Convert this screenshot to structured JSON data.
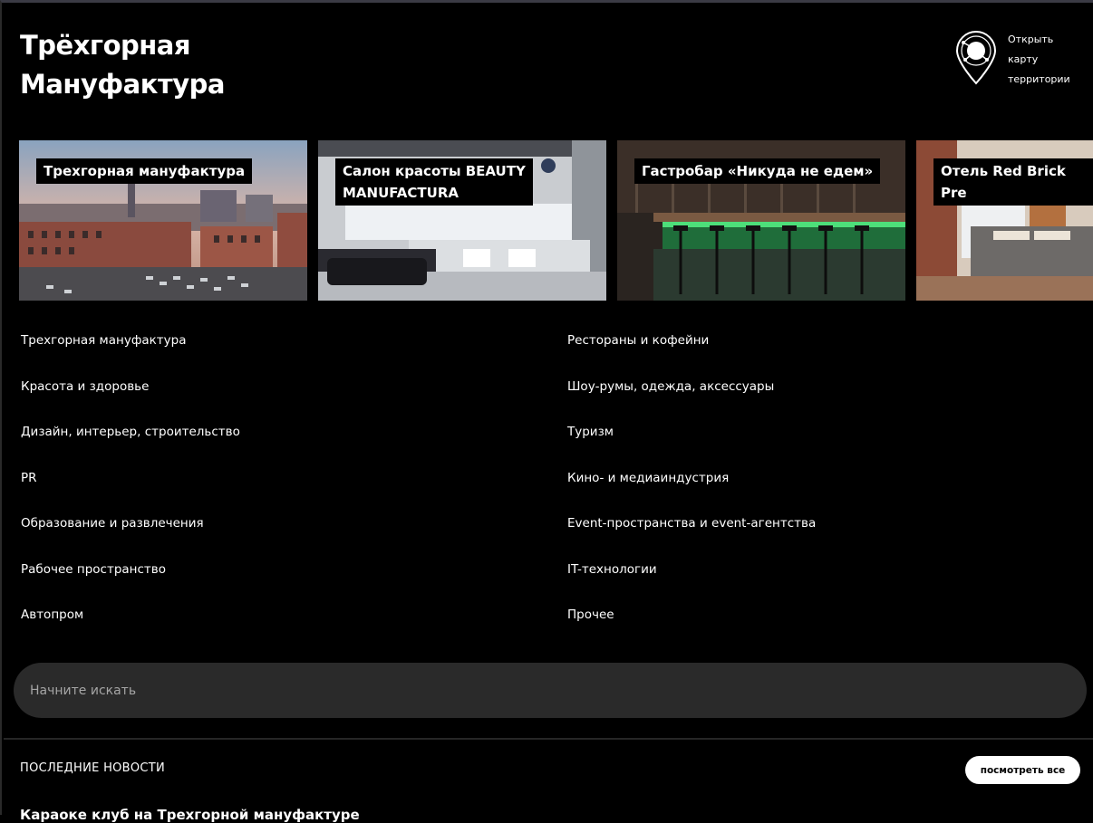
{
  "header": {
    "logo_line1": "Трёхгорная",
    "logo_line2": "Мануфактура",
    "map_link": [
      "Открыть",
      "карту",
      "территории"
    ]
  },
  "cards": [
    {
      "label": "Трехгорная мануфактура"
    },
    {
      "label": "Салон красоты BEAUTY\nMANUFACTURA"
    },
    {
      "label": "Гастробар «Никуда не едем»"
    },
    {
      "label": "Отель Red Brick Pre"
    }
  ],
  "categories": [
    "Трехгорная мануфактура",
    "Рестораны и кофейни",
    "Красота и здоровье",
    "Шоу-румы, одежда, аксессуары",
    "Дизайн, интерьер, строительство",
    "Туризм",
    "PR",
    "Кино- и медиаиндустрия",
    "Образование и развлечения",
    "Event-пространства и event-агентства",
    "Рабочее пространство",
    "IT-технологии",
    "Автопром",
    "Прочее"
  ],
  "search": {
    "placeholder": "Начните искать"
  },
  "news": {
    "heading": "ПОСЛЕДНИЕ НОВОСТИ",
    "view_all": "посмотреть все",
    "first_title": "Караоке клуб на Трехгорной мануфактуре"
  }
}
